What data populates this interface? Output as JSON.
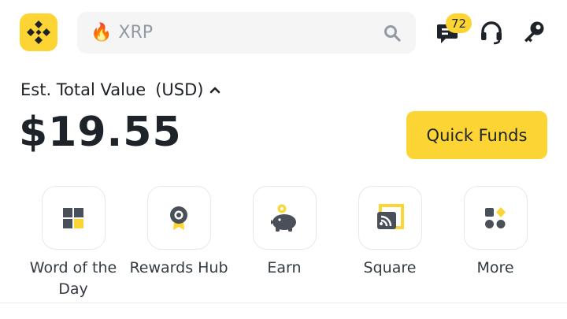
{
  "header": {
    "search": {
      "query": "XRP",
      "trend_icon": "fire-icon"
    },
    "messages_badge": "72"
  },
  "balance": {
    "label": "Est. Total Value",
    "currency": "(USD)",
    "amount": "$19.55"
  },
  "quick_funds_label": "Quick Funds",
  "shortcuts": [
    {
      "label": "Word of the Day",
      "icon": "grid-puzzle-icon"
    },
    {
      "label": "Rewards Hub",
      "icon": "medal-icon"
    },
    {
      "label": "Earn",
      "icon": "piggy-bank-icon"
    },
    {
      "label": "Square",
      "icon": "square-feed-icon"
    },
    {
      "label": "More",
      "icon": "more-apps-icon"
    }
  ],
  "colors": {
    "accent": "#fcd535",
    "text": "#1e2329",
    "muted": "#929aa5"
  }
}
